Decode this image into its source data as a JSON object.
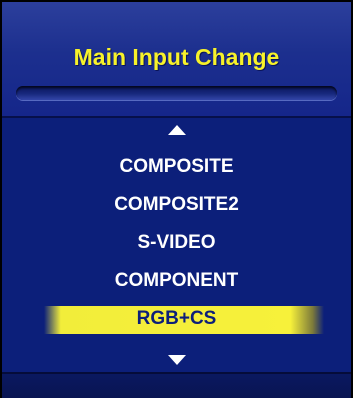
{
  "menu": {
    "title": "Main Input Change",
    "items": [
      {
        "label": "COMPOSITE",
        "selected": false
      },
      {
        "label": "COMPOSITE2",
        "selected": false
      },
      {
        "label": "S-VIDEO",
        "selected": false
      },
      {
        "label": "COMPONENT",
        "selected": false
      },
      {
        "label": "RGB+CS",
        "selected": true
      }
    ],
    "scroll_up_icon": "triangle-up",
    "scroll_down_icon": "triangle-down"
  },
  "colors": {
    "background": "#0c1f7a",
    "title_text": "#f7f22a",
    "item_text": "#ffffff",
    "highlight": "#f7f13a",
    "border": "#000000"
  }
}
